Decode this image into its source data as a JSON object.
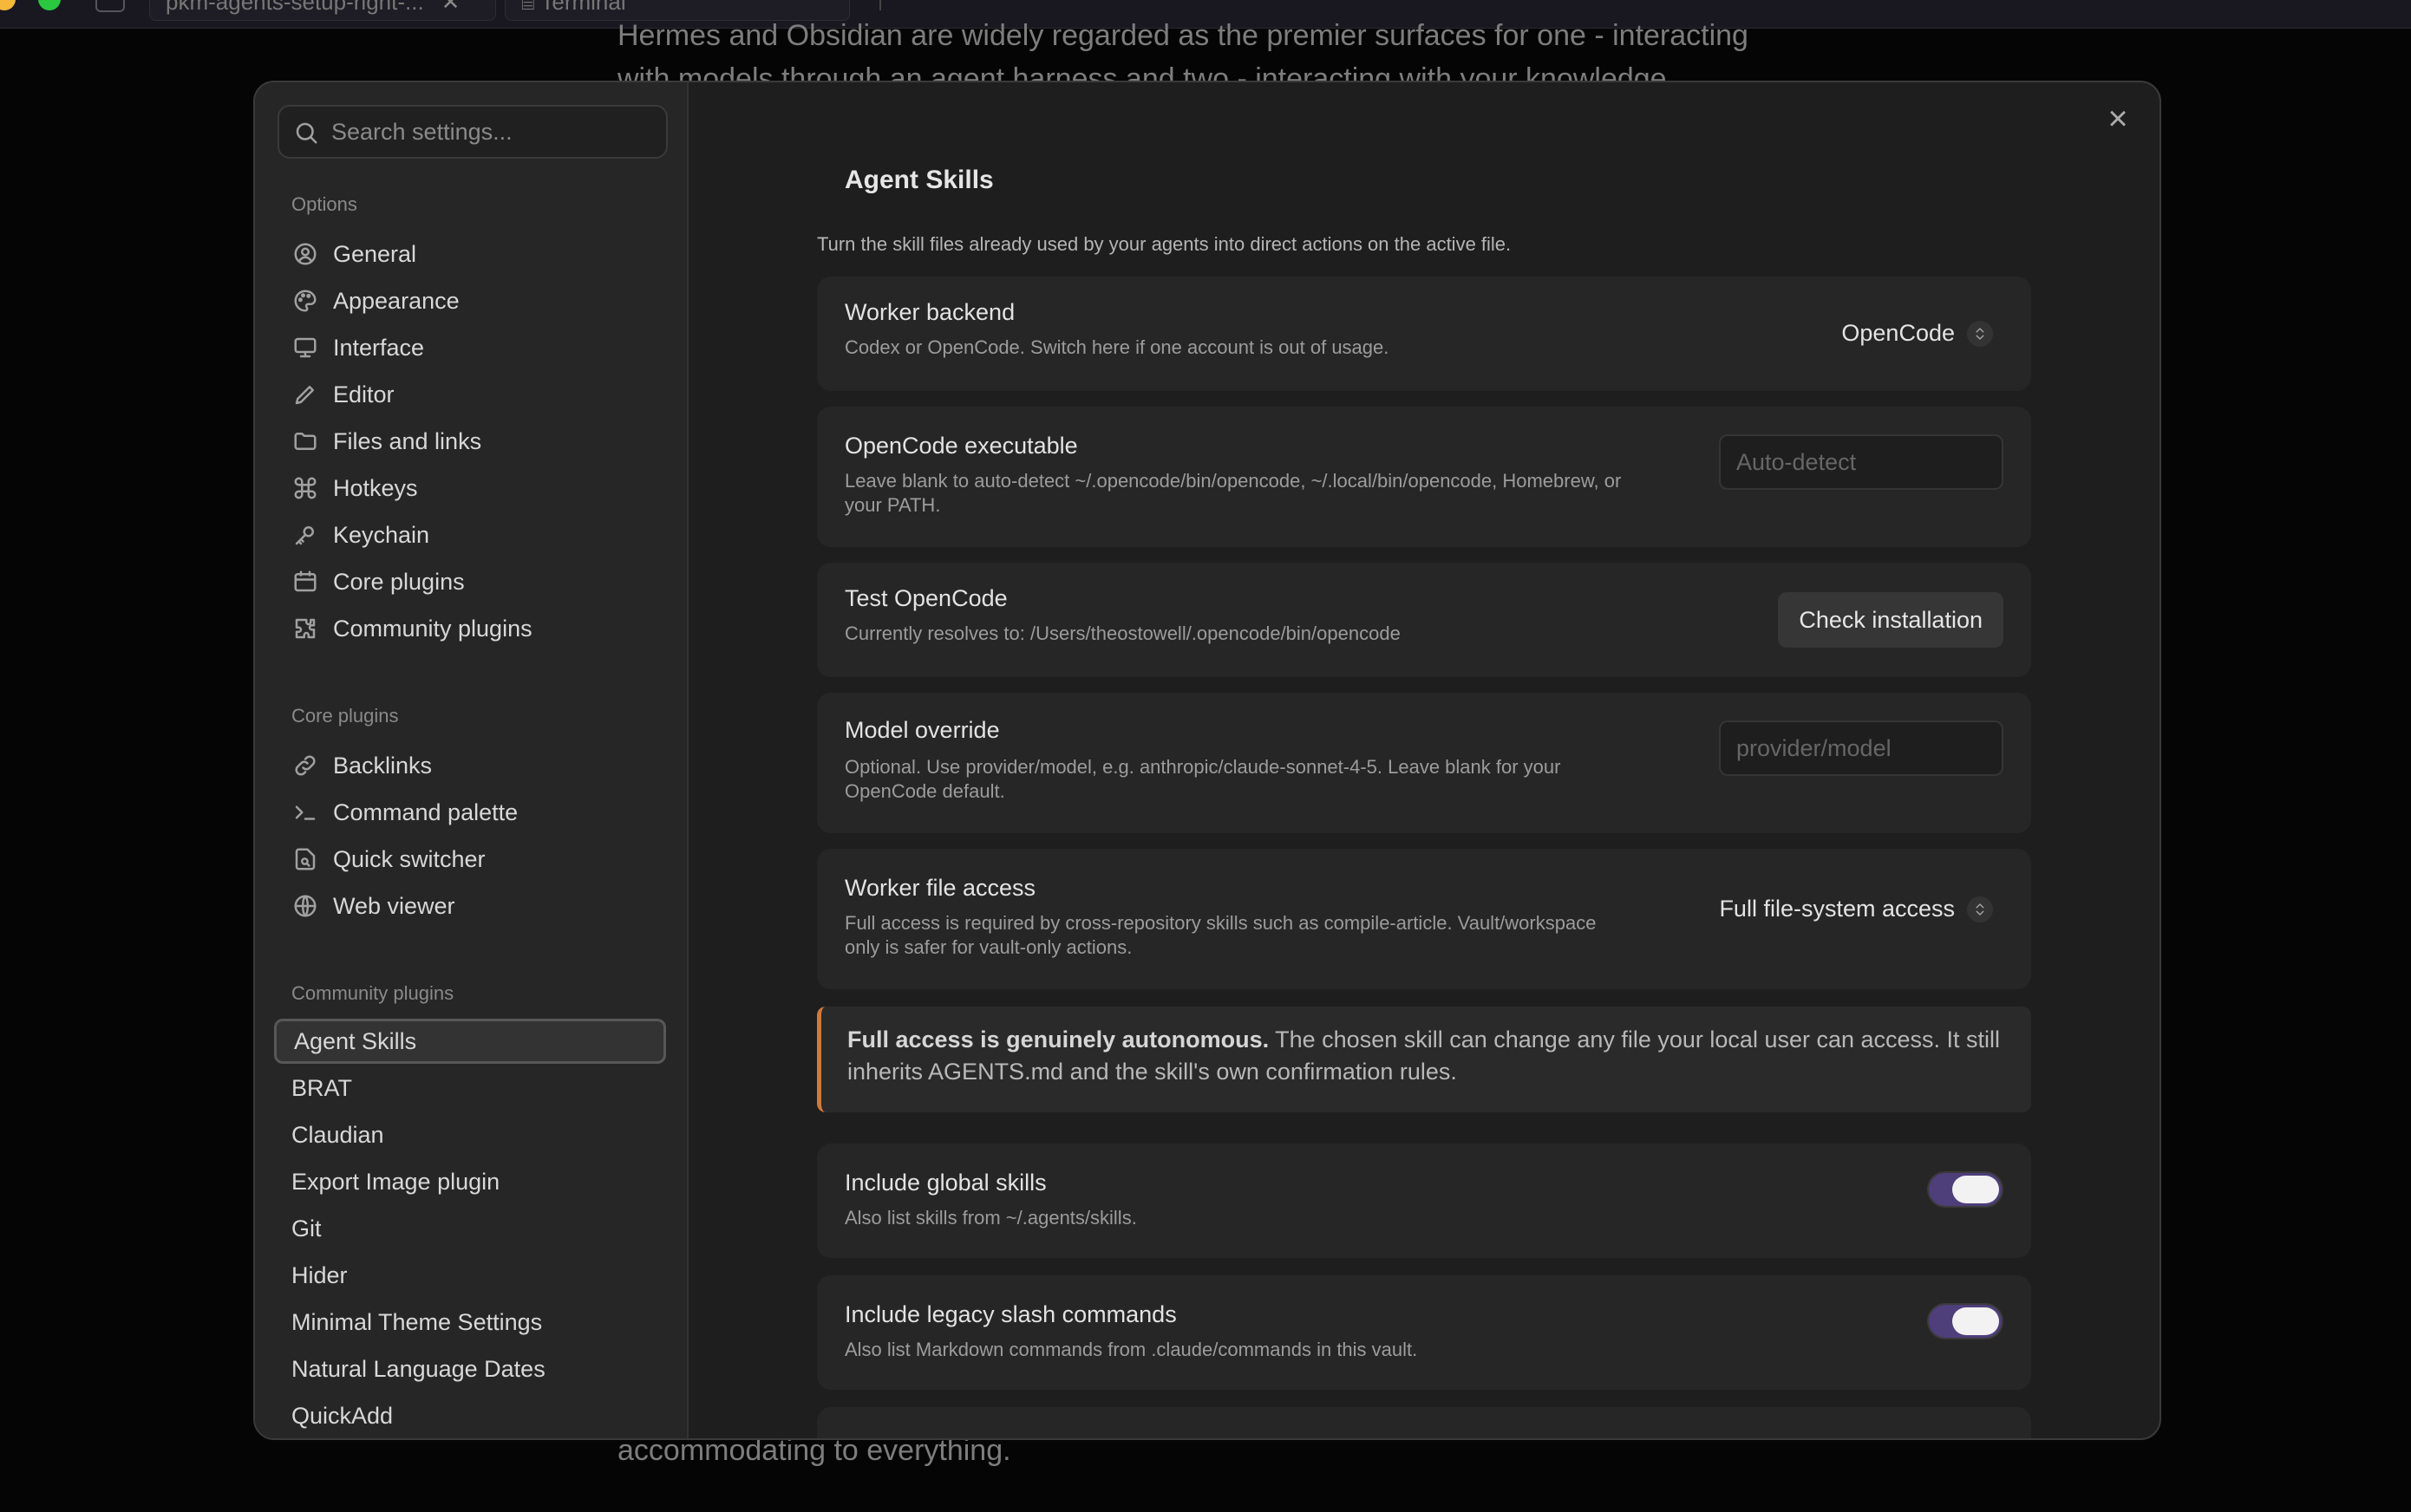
{
  "topbar": {
    "tab1": "pkm-agents-setup-right-...",
    "tab2": "Terminal"
  },
  "background_doc": {
    "line1": "Hermes and Obsidian are widely regarded as the premier surfaces for one - interacting",
    "line2": "with models through an agent harness and two - interacting with your knowledge",
    "line3": "accommodating to everything."
  },
  "sidebar": {
    "search_placeholder": "Search settings...",
    "options_title": "Options",
    "options": [
      {
        "label": "General",
        "icon": "user-circle-icon"
      },
      {
        "label": "Appearance",
        "icon": "palette-icon"
      },
      {
        "label": "Interface",
        "icon": "monitor-icon"
      },
      {
        "label": "Editor",
        "icon": "pencil-icon"
      },
      {
        "label": "Files and links",
        "icon": "folder-icon"
      },
      {
        "label": "Hotkeys",
        "icon": "command-icon"
      },
      {
        "label": "Keychain",
        "icon": "key-icon"
      },
      {
        "label": "Core plugins",
        "icon": "calendar-icon"
      },
      {
        "label": "Community plugins",
        "icon": "puzzle-icon"
      }
    ],
    "core_title": "Core plugins",
    "core": [
      {
        "label": "Backlinks",
        "icon": "backlink-icon"
      },
      {
        "label": "Command palette",
        "icon": "terminal-icon"
      },
      {
        "label": "Quick switcher",
        "icon": "file-search-icon"
      },
      {
        "label": "Web viewer",
        "icon": "globe-icon"
      }
    ],
    "community_title": "Community plugins",
    "community": [
      "Agent Skills",
      "BRAT",
      "Claudian",
      "Export Image plugin",
      "Git",
      "Hider",
      "Minimal Theme Settings",
      "Natural Language Dates",
      "QuickAdd"
    ]
  },
  "content": {
    "title": "Agent Skills",
    "description": "Turn the skill files already used by your agents into direct actions on the active file.",
    "worker_backend": {
      "name": "Worker backend",
      "desc": "Codex or OpenCode. Switch here if one account is out of usage.",
      "value": "OpenCode"
    },
    "opencode_exec": {
      "name": "OpenCode executable",
      "desc1": "Leave blank to auto-detect ~/.opencode/bin/opencode, ~/.local/bin/opencode, Homebrew, or",
      "desc2": "your PATH.",
      "placeholder": "Auto-detect"
    },
    "test_opencode": {
      "name": "Test OpenCode",
      "desc": "Currently resolves to: /Users/theostowell/.opencode/bin/opencode",
      "button": "Check installation"
    },
    "model_override": {
      "name": "Model override",
      "desc1": "Optional. Use provider/model, e.g. anthropic/claude-sonnet-4-5. Leave blank for your",
      "desc2": "OpenCode default.",
      "placeholder": "provider/model"
    },
    "file_access": {
      "name": "Worker file access",
      "desc1": "Full access is required by cross-repository skills such as compile-article. Vault/workspace",
      "desc2": "only is safer for vault-only actions.",
      "value": "Full file-system access"
    },
    "callout": {
      "bold": "Full access is genuinely autonomous.",
      "text": " The chosen skill can change any file your local user can access. It still inherits AGENTS.md and the skill's own confirmation rules."
    },
    "global_skills": {
      "name": "Include global skills",
      "desc": "Also list skills from ~/.agents/skills."
    },
    "legacy_commands": {
      "name": "Include legacy slash commands",
      "desc": "Also list Markdown commands from .claude/commands in this vault."
    }
  },
  "colors": {
    "accent_toggle": "#4e3e7a",
    "callout_border": "#d07a3a"
  }
}
